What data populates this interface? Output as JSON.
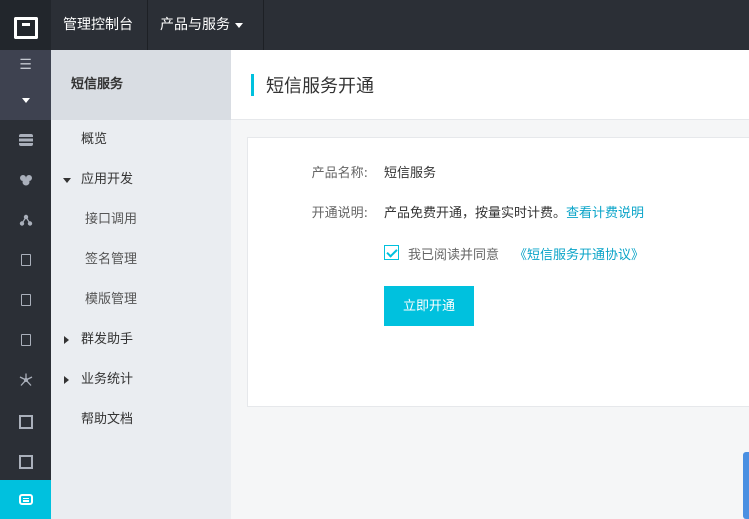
{
  "topbar": {
    "console_label": "管理控制台",
    "products_label": "产品与服务"
  },
  "rail": {
    "menu_glyph": "☰",
    "items": [
      "storage-icon",
      "cloud-icon",
      "network-icon",
      "box-icon",
      "box-icon",
      "box-icon",
      "share-icon",
      "mini-logo-icon",
      "mini-logo-icon",
      "chat-icon"
    ]
  },
  "subnav": {
    "title": "短信服务",
    "items": [
      {
        "label": "概览"
      },
      {
        "label": "应用开发"
      },
      {
        "label": "接口调用"
      },
      {
        "label": "签名管理"
      },
      {
        "label": "模版管理"
      },
      {
        "label": "群发助手"
      },
      {
        "label": "业务统计"
      },
      {
        "label": "帮助文档"
      }
    ]
  },
  "page": {
    "title": "短信服务开通",
    "product_label": "产品名称:",
    "product_value": "短信服务",
    "desc_label": "开通说明:",
    "desc_value": "产品免费开通，按量实时计费。",
    "desc_link": "查看计费说明",
    "agree_text": "我已阅读并同意",
    "agree_link": "《短信服务开通协议》",
    "agree_checked": true,
    "submit_label": "立即开通"
  },
  "colors": {
    "accent": "#00c1de",
    "link": "#0aa4c8",
    "topbar": "#2b2f36"
  }
}
